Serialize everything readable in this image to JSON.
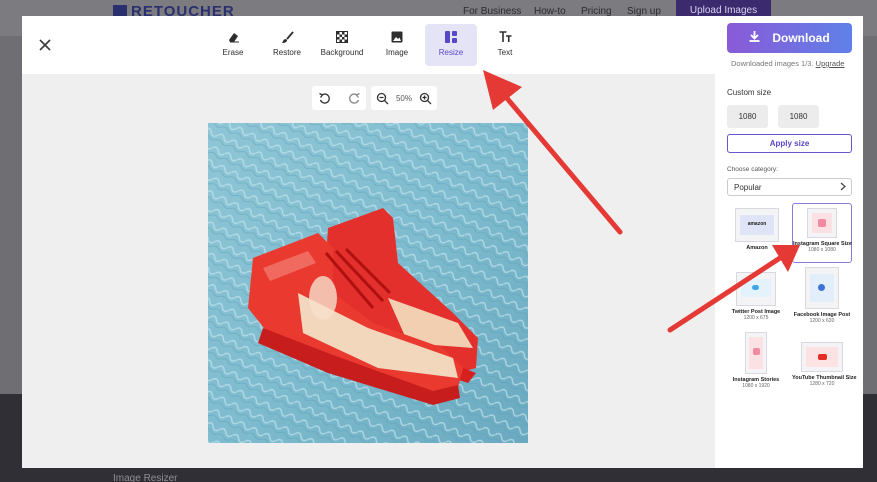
{
  "background_site": {
    "logo": "RETOUCHER",
    "nav": [
      "For Business",
      "How-to",
      "Pricing",
      "Sign up"
    ],
    "upload_button": "Upload Images",
    "footer_text": "Image Resizer"
  },
  "toolbar": {
    "tools": [
      {
        "label": "Erase",
        "icon": "eraser-icon"
      },
      {
        "label": "Restore",
        "icon": "brush-icon"
      },
      {
        "label": "Background",
        "icon": "checker-icon"
      },
      {
        "label": "Image",
        "icon": "image-icon"
      },
      {
        "label": "Resize",
        "icon": "layout-icon",
        "active": true
      },
      {
        "label": "Text",
        "icon": "text-icon"
      }
    ]
  },
  "canvas": {
    "zoom": "50%"
  },
  "download": {
    "label": "Download",
    "note_prefix": "Downloaded images 1/3.",
    "upgrade": "Upgrade"
  },
  "custom_size": {
    "title": "Custom size",
    "width": "1080",
    "height": "1080",
    "separator": "×",
    "apply": "Apply size"
  },
  "category": {
    "label": "Choose category:",
    "selected": "Popular"
  },
  "presets": [
    {
      "name": "Amazon",
      "dims": "",
      "brand": "amazon"
    },
    {
      "name": "Instagram Square Size",
      "dims": "1080 x 1080",
      "selected": true
    },
    {
      "name": "Twitter Post Image",
      "dims": "1200 x 675"
    },
    {
      "name": "Facebook Image Post",
      "dims": "1200 x 630"
    },
    {
      "name": "Instagram Stories",
      "dims": "1080 x 1920"
    },
    {
      "name": "YouTube Thumbnail Size",
      "dims": "1280 x 720"
    }
  ],
  "colors": {
    "accent": "#5846c8",
    "download_gradient_start": "#8a5ad8",
    "download_gradient_end": "#5f80e8",
    "annotation_arrow": "#e53935"
  }
}
